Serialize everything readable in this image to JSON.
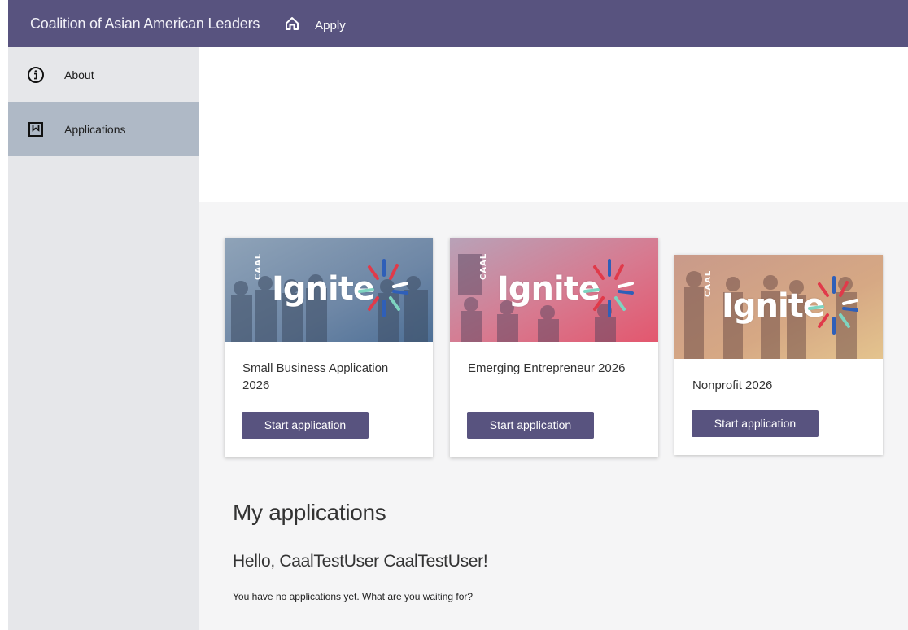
{
  "header": {
    "brand": "Coalition of Asian American Leaders",
    "home_icon": "home-icon",
    "apply_label": "Apply",
    "bg_color": "#58537f"
  },
  "sidebar": {
    "items": [
      {
        "label": "About",
        "icon": "info-icon",
        "active": false
      },
      {
        "label": "Applications",
        "icon": "bookmark-icon",
        "active": true
      }
    ]
  },
  "programs": [
    {
      "banner_text": "Ignite",
      "banner_side_text": "CAAL",
      "title": "Small Business Application 2026",
      "button": "Start application",
      "tint": "#6d88a6"
    },
    {
      "banner_text": "Ignite",
      "banner_side_text": "CAAL",
      "title": "Emerging Entrepreneur 2026",
      "button": "Start application",
      "tint": "#d97088"
    },
    {
      "banner_text": "Ignite",
      "banner_side_text": "CAAL",
      "title": "Nonprofit 2026",
      "button": "Start application",
      "tint": "#d9a37f"
    }
  ],
  "my_applications": {
    "heading": "My applications",
    "greeting": "Hello, CaalTestUser CaalTestUser!",
    "empty_message": "You have no applications yet. What are you waiting for?"
  }
}
